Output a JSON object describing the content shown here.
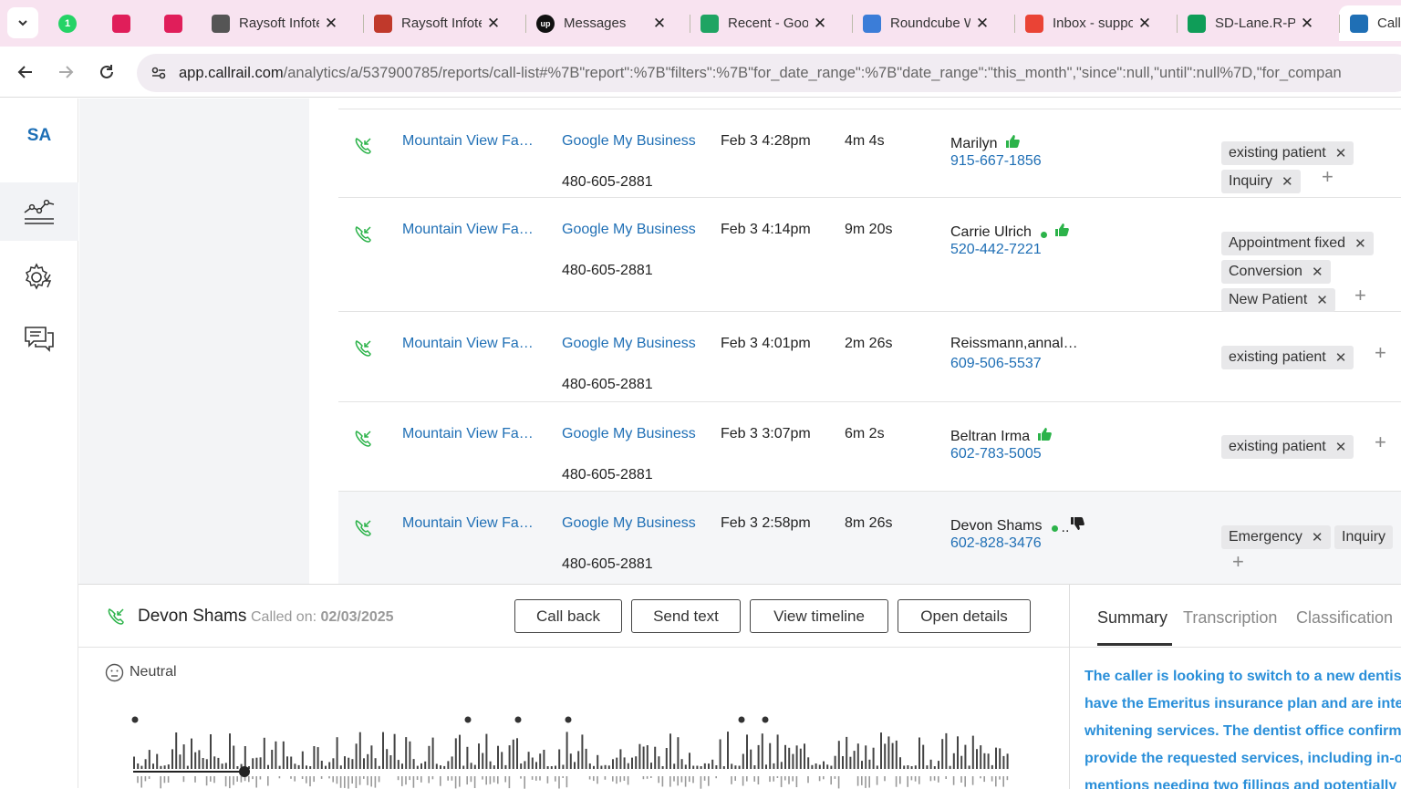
{
  "browser": {
    "tabs": [
      {
        "title": "",
        "icon": "whatsapp-icon",
        "color": "#25d366"
      },
      {
        "title": "",
        "icon": "slack-icon",
        "color": "#e01e5a"
      },
      {
        "title": "",
        "icon": "slack-icon",
        "color": "#e01e5a"
      },
      {
        "title": "Raysoft Infotech",
        "icon": "globe-icon",
        "color": "#555555"
      },
      {
        "title": "Raysoft Infotech",
        "icon": "school-icon",
        "color": "#c0392b"
      },
      {
        "title": "Messages",
        "icon": "upwork-icon",
        "color": "#111111"
      },
      {
        "title": "Recent - Google Drive",
        "icon": "drive-icon",
        "color": "#1fa463"
      },
      {
        "title": "Roundcube Webmail",
        "icon": "roundcube-icon",
        "color": "#3b7dd8"
      },
      {
        "title": "Inbox - support",
        "icon": "gmail-icon",
        "color": "#ea4335"
      },
      {
        "title": "SD-Lane.R-Pre",
        "icon": "sheets-icon",
        "color": "#0f9d58"
      },
      {
        "title": "Call",
        "icon": "callrail-icon",
        "color": "#1f6fb5"
      }
    ],
    "url_domain": "app.callrail.com",
    "url_path": "/analytics/a/537900785/reports/call-list#%7B\"report\":%7B\"filters\":%7B\"for_date_range\":%7B\"date_range\":\"this_month\",\"since\":null,\"until\":null%7D,\"for_compan"
  },
  "sidebar": {
    "initials": "SA"
  },
  "calls": [
    {
      "company": "Mountain View Fa…",
      "source": "Google My Business",
      "tracking_number": "480-605-2881",
      "datetime": "Feb 3 4:28pm",
      "duration": "4m 4s",
      "caller": "Marilyn",
      "caller_phone": "915-667-1856",
      "status_dot": false,
      "rating": "up",
      "tags": [
        "existing patient",
        "Inquiry"
      ]
    },
    {
      "company": "Mountain View Fa…",
      "source": "Google My Business",
      "tracking_number": "480-605-2881",
      "datetime": "Feb 3 4:14pm",
      "duration": "9m 20s",
      "caller": "Carrie Ulrich",
      "caller_phone": "520-442-7221",
      "status_dot": true,
      "rating": "up",
      "tags": [
        "Appointment fixed",
        "Conversion",
        "New Patient"
      ]
    },
    {
      "company": "Mountain View Fa…",
      "source": "Google My Business",
      "tracking_number": "480-605-2881",
      "datetime": "Feb 3 4:01pm",
      "duration": "2m 26s",
      "caller": "Reissmann,annal…",
      "caller_phone": "609-506-5537",
      "status_dot": false,
      "rating": "",
      "tags": [
        "existing patient"
      ]
    },
    {
      "company": "Mountain View Fa…",
      "source": "Google My Business",
      "tracking_number": "480-605-2881",
      "datetime": "Feb 3 3:07pm",
      "duration": "6m 2s",
      "caller": "Beltran Irma",
      "caller_phone": "602-783-5005",
      "status_dot": false,
      "rating": "up",
      "tags": [
        "existing patient"
      ]
    },
    {
      "company": "Mountain View Fa…",
      "source": "Google My Business",
      "tracking_number": "480-605-2881",
      "datetime": "Feb 3 2:58pm",
      "duration": "8m 26s",
      "caller": "Devon Shams",
      "caller_phone": "602-828-3476",
      "status_dot": true,
      "rating": "down",
      "tags": [
        "Emergency",
        "Inquiry"
      ]
    }
  ],
  "detail": {
    "caller_name": "Devon Shams",
    "called_on_label": "Called on:",
    "called_on_date": "02/03/2025",
    "sentiment": "Neutral",
    "buttons": {
      "call_back": "Call back",
      "send_text": "Send text",
      "view_timeline": "View timeline",
      "open_details": "Open details"
    },
    "tabs": [
      "Summary",
      "Transcription",
      "Classification"
    ],
    "summary_lines": [
      "The caller is looking to switch to a new dentist",
      "have the Emeritus insurance plan and are inter",
      "whitening services. The dentist office confirms",
      "provide the requested services, including in-of",
      "mentions needing two fillings and potentially"
    ]
  },
  "colors": {
    "link": "#1f6fb5",
    "green": "#2cb34a",
    "summary_text": "#2a8fd9",
    "tab_strip": "#f8e3f0"
  }
}
